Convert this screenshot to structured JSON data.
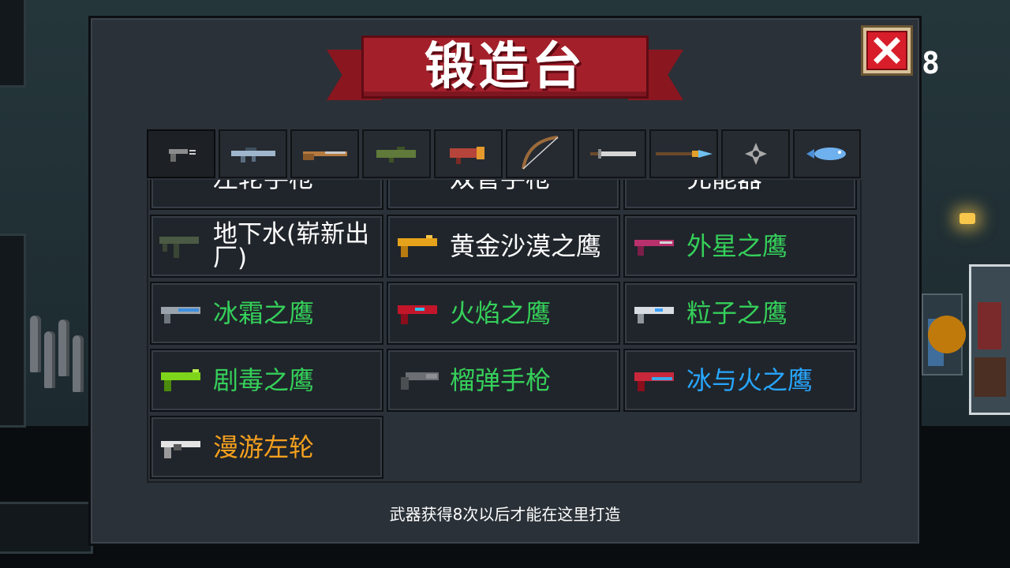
{
  "header": {
    "title": "锻造台",
    "counter": "8"
  },
  "tabs": [
    {
      "icon": "pistol-icon"
    },
    {
      "icon": "rifle-icon"
    },
    {
      "icon": "shotgun-icon"
    },
    {
      "icon": "launcher-icon"
    },
    {
      "icon": "heavy-gun-icon"
    },
    {
      "icon": "bow-icon"
    },
    {
      "icon": "sword-icon"
    },
    {
      "icon": "spear-icon"
    },
    {
      "icon": "throwing-star-icon"
    },
    {
      "icon": "fish-icon"
    }
  ],
  "partial_row": [
    "左轮手枪",
    "双管手枪",
    "充能器"
  ],
  "weapons": [
    {
      "name": "地下水(崭新出厂)",
      "color": "white",
      "gun_color": "#4b5a44"
    },
    {
      "name": "黄金沙漠之鹰",
      "color": "white",
      "gun_color": "#e6a21b"
    },
    {
      "name": "外星之鹰",
      "color": "green",
      "gun_color": "#b8316c"
    },
    {
      "name": "冰霜之鹰",
      "color": "green",
      "gun_color": "#7fb3e0"
    },
    {
      "name": "火焰之鹰",
      "color": "green",
      "gun_color": "#c3162a"
    },
    {
      "name": "粒子之鹰",
      "color": "green",
      "gun_color": "#d7dde2"
    },
    {
      "name": "剧毒之鹰",
      "color": "green",
      "gun_color": "#7ed41a"
    },
    {
      "name": "榴弹手枪",
      "color": "green",
      "gun_color": "#6b6f73"
    },
    {
      "name": "冰与火之鹰",
      "color": "blue",
      "gun_color": "#c8283a"
    },
    {
      "name": "漫游左轮",
      "color": "orange",
      "gun_color": "#e4e4e4"
    }
  ],
  "footer": {
    "note": "武器获得8次以后才能在这里打造"
  },
  "colors": {
    "green": "#35d05a",
    "blue": "#27a6ff",
    "orange": "#f5a01e",
    "banner": "#a3202b"
  }
}
